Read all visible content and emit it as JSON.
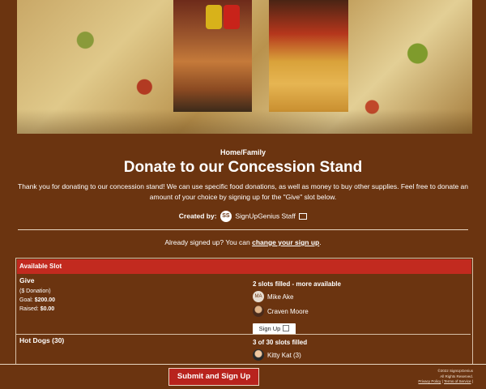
{
  "category": "Home/Family",
  "title": "Donate to our Concession Stand",
  "description": "Thank you for donating to our concession stand! We can use specific food donations, as well as money to buy other supplies. Feel free to donate an amount of your choice by signing up for the \"Give\" slot below.",
  "creator": {
    "label": "Created by:",
    "initials": "SS",
    "name": "SignUpGenius Staff"
  },
  "signed_in": {
    "text": "Already signed up? You can ",
    "link": "change your sign up",
    "suffix": "."
  },
  "table": {
    "header": "Available Slot",
    "rows": [
      {
        "name": "Give",
        "sub": "($ Donation)",
        "goal_label": "Goal:",
        "goal": "$200.00",
        "raised_label": "Raised:",
        "raised": "$0.00",
        "status": "2 slots filled - more available",
        "people": [
          {
            "initials": "MA",
            "name": "Mike Ake"
          },
          {
            "initials": "",
            "name": "Craven Moore"
          }
        ],
        "button": "Sign Up"
      },
      {
        "name": "Hot Dogs (30)",
        "status": "3 of 30 slots filled",
        "people": [
          {
            "initials": "",
            "name": "Kitty Kat (3)"
          }
        ]
      }
    ]
  },
  "footer": {
    "submit": "Submit and Sign Up",
    "copyright": "©2022 SignUpGenius",
    "rights": "All Rights Reserved.",
    "privacy": "Privacy Policy",
    "sep": "|",
    "terms": "Terms of Service",
    "tail": "|"
  },
  "colors": {
    "background": "#6b3410",
    "header_red": "#c22a1f",
    "button_red": "#b8231d"
  }
}
